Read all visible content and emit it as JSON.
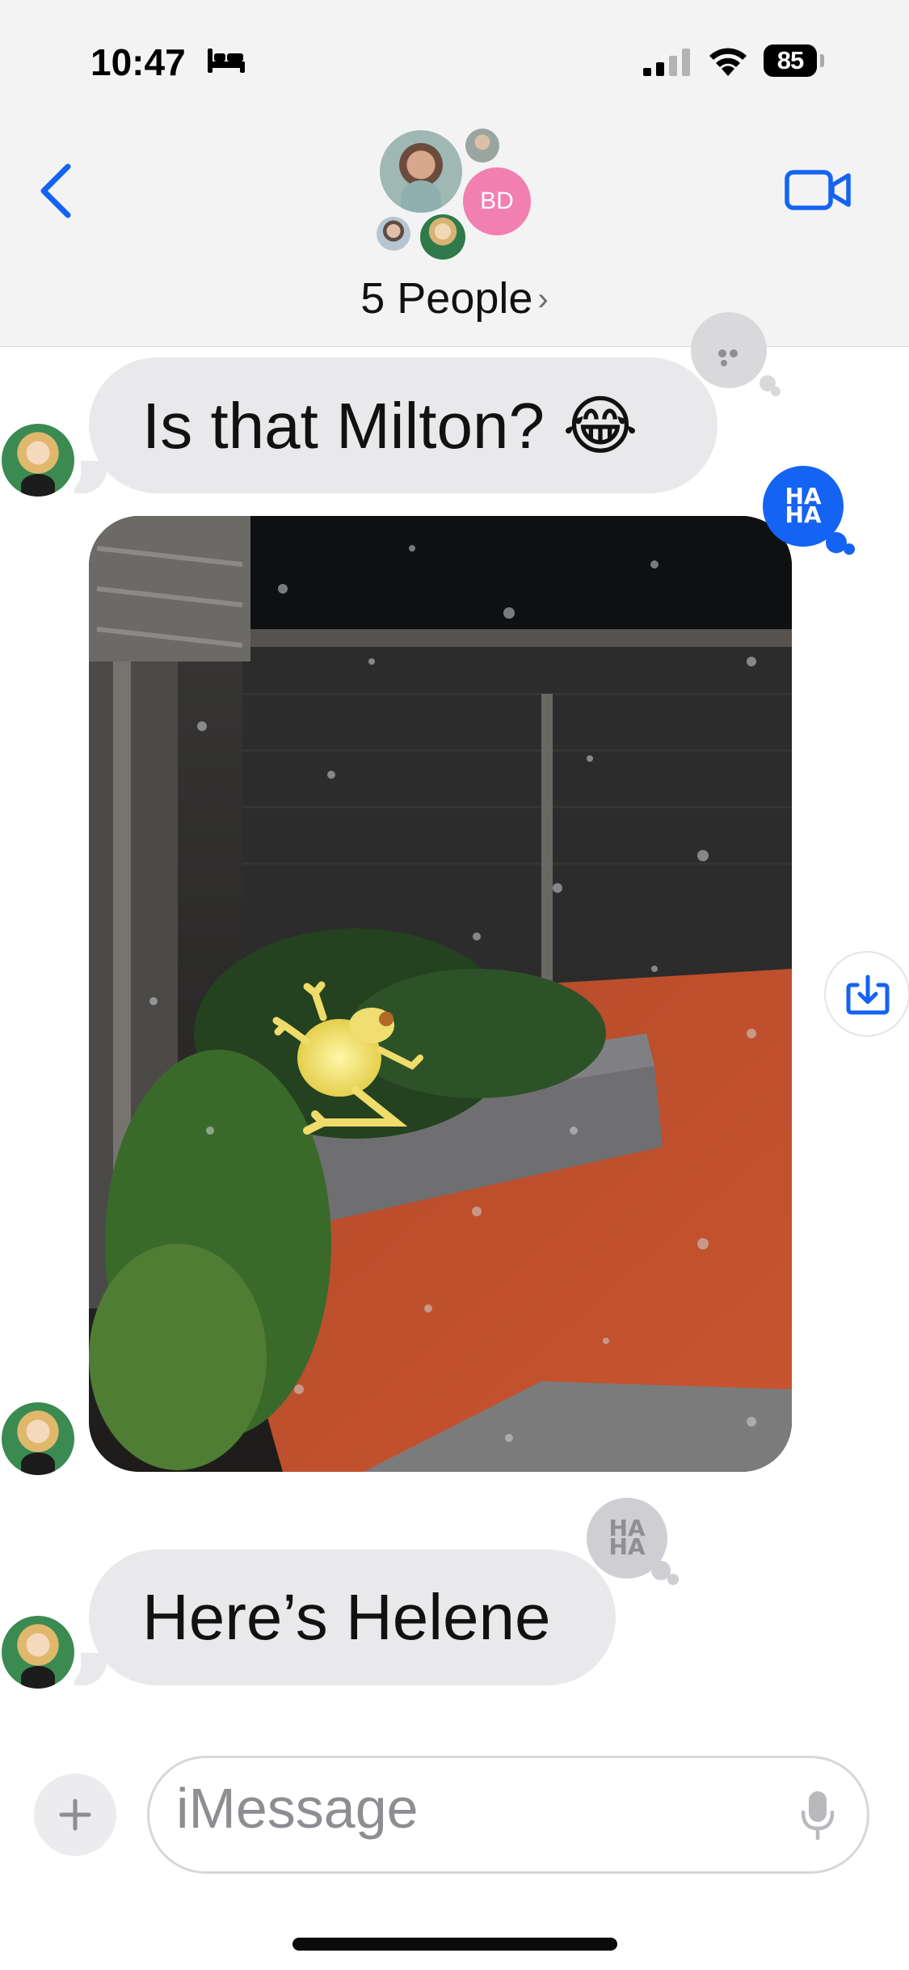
{
  "status_bar": {
    "time": "10:47",
    "battery": "85",
    "icons": [
      "bed-icon",
      "signal-icon",
      "wifi-icon",
      "battery-icon"
    ]
  },
  "header": {
    "title": "5 People",
    "chevron": "›",
    "avatar_initials": "BD",
    "icons": [
      "chevron-left-icon",
      "video-camera-icon"
    ],
    "accent_color": "#1463f3"
  },
  "messages": [
    {
      "type": "text",
      "text": "Is that Milton? 😂",
      "tapback": "HA HA"
    },
    {
      "type": "image",
      "tapback": "HA HA",
      "icons": [
        "frog-photo",
        "save-download-icon"
      ]
    },
    {
      "type": "text",
      "text": "Here’s Helene",
      "tapback": "HA HA"
    }
  ],
  "composer": {
    "placeholder": "iMessage",
    "plus_label": "+",
    "icons": [
      "plus-icon",
      "microphone-icon"
    ]
  },
  "tapback_text": {
    "line1": "HA",
    "line2": "HA"
  },
  "colors": {
    "bubble_gray": "#e9e9eb",
    "tapback_blue": "#1463f3",
    "tapback_gray": "#cfcfd3",
    "avatar_pink": "#f17fb0"
  }
}
